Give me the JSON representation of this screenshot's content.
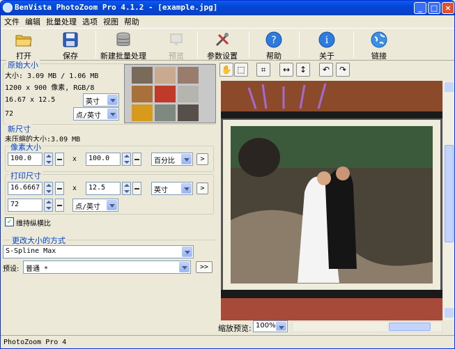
{
  "window": {
    "title": "BenVista PhotoZoom Pro 4.1.2 - [example.jpg]",
    "min": "_",
    "max": "□",
    "close": "×"
  },
  "menu": [
    "文件",
    "编辑",
    "批量处理",
    "选项",
    "视图",
    "帮助"
  ],
  "toolbar": {
    "open": "打开",
    "save": "保存",
    "batch": "新建批量处理",
    "preview": "预览",
    "settings": "参数设置",
    "help": "帮助",
    "about": "关于",
    "link": "链接"
  },
  "original": {
    "title": "原始大小",
    "size": "大小: 3.09 MB / 1.06 MB",
    "pixels": "1200 x 900 像素, RGB/8",
    "dims": "16.67 x 12.5",
    "dims_unit": "英寸",
    "res": "72",
    "res_unit": "点/英寸"
  },
  "newsize": {
    "title": "新尺寸",
    "uncompressed": "未压缩的大小:3.09 MB",
    "pixel": {
      "title": "像素大小",
      "width": "100.0",
      "height": "100.0",
      "unit": "百分比",
      "x": "x"
    },
    "print": {
      "title": "打印尺寸",
      "width": "16.6667",
      "height": "12.5",
      "unit": "英寸",
      "res": "72",
      "res_unit": "点/英寸",
      "x": "x"
    },
    "keep_ratio": "维持纵横比"
  },
  "resize": {
    "title": "更改大小的方式",
    "method": "S-Spline Max",
    "preset_label": "预设:",
    "preset": "普通 *",
    "go": ">>"
  },
  "zoom": {
    "label": "缩放预览:",
    "value": "100%"
  },
  "status": {
    "text": "PhotoZoom Pro 4"
  },
  "colors": {
    "titlebar": "#0347d6",
    "group_title": "#0046d5",
    "face": "#ece9d8"
  }
}
